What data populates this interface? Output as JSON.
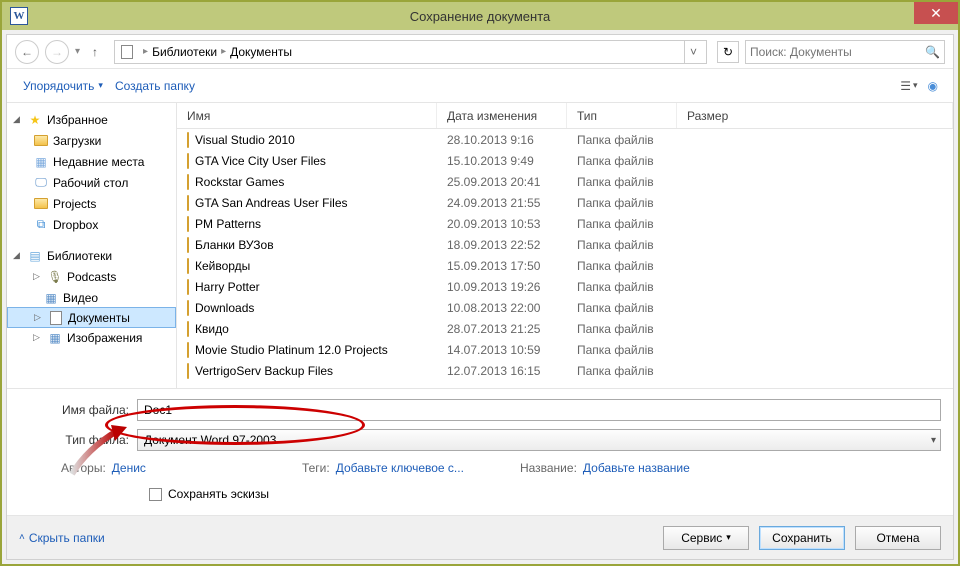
{
  "titlebar": {
    "title": "Сохранение документа"
  },
  "breadcrumb": {
    "part1": "Библиотеки",
    "part2": "Документы"
  },
  "search": {
    "placeholder": "Поиск: Документы"
  },
  "toolbar": {
    "organize": "Упорядочить",
    "newfolder": "Создать папку"
  },
  "sidebar": {
    "favorites": "Избранное",
    "fav_items": [
      "Загрузки",
      "Недавние места",
      "Рабочий стол",
      "Projects",
      "Dropbox"
    ],
    "libraries": "Библиотеки",
    "lib_items": [
      "Podcasts",
      "Видео",
      "Документы",
      "Изображения"
    ]
  },
  "columns": {
    "name": "Имя",
    "date": "Дата изменения",
    "type": "Тип",
    "size": "Размер"
  },
  "files": [
    {
      "name": "Visual Studio 2010",
      "date": "28.10.2013 9:16",
      "type": "Папка файлів"
    },
    {
      "name": "GTA Vice City User Files",
      "date": "15.10.2013 9:49",
      "type": "Папка файлів"
    },
    {
      "name": "Rockstar Games",
      "date": "25.09.2013 20:41",
      "type": "Папка файлів"
    },
    {
      "name": "GTA San Andreas User Files",
      "date": "24.09.2013 21:55",
      "type": "Папка файлів"
    },
    {
      "name": "PM Patterns",
      "date": "20.09.2013 10:53",
      "type": "Папка файлів"
    },
    {
      "name": "Бланки ВУЗов",
      "date": "18.09.2013 22:52",
      "type": "Папка файлів"
    },
    {
      "name": "Кейворды",
      "date": "15.09.2013 17:50",
      "type": "Папка файлів"
    },
    {
      "name": "Harry Potter",
      "date": "10.09.2013 19:26",
      "type": "Папка файлів"
    },
    {
      "name": "Downloads",
      "date": "10.08.2013 22:00",
      "type": "Папка файлів"
    },
    {
      "name": "Квидо",
      "date": "28.07.2013 21:25",
      "type": "Папка файлів"
    },
    {
      "name": "Movie Studio Platinum 12.0 Projects",
      "date": "14.07.2013 10:59",
      "type": "Папка файлів"
    },
    {
      "name": "VertrigoServ Backup Files",
      "date": "12.07.2013 16:15",
      "type": "Папка файлів"
    }
  ],
  "fields": {
    "filename_label": "Имя файла:",
    "filename_value": "Doc1",
    "filetype_label": "Тип файла:",
    "filetype_value": "Документ Word 97-2003"
  },
  "meta": {
    "authors_label": "Авторы:",
    "authors_value": "Денис",
    "tags_label": "Теги:",
    "tags_value": "Добавьте ключевое с...",
    "title_label": "Название:",
    "title_value": "Добавьте название"
  },
  "thumb_checkbox": "Сохранять эскизы",
  "footer": {
    "hide": "Скрыть папки",
    "tools": "Сервис",
    "save": "Сохранить",
    "cancel": "Отмена"
  }
}
